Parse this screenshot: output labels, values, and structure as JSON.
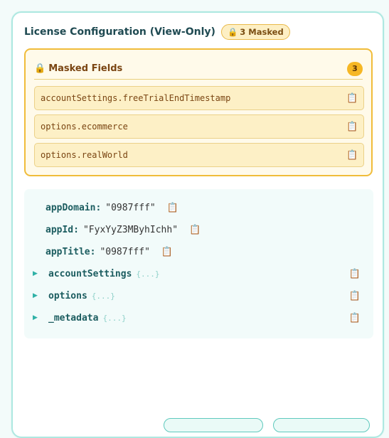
{
  "header": {
    "title": "License Configuration (View-Only)",
    "badge_icon": "lock-icon",
    "badge_label": "3 Masked"
  },
  "masked": {
    "title": "Masked Fields",
    "count": "3",
    "fields": [
      "accountSettings.freeTrialEndTimestamp",
      "options.ecommerce",
      "options.realWorld"
    ]
  },
  "tree": {
    "rows": [
      {
        "key": "appDomain:",
        "value": "\"0987fff\""
      },
      {
        "key": "appId:",
        "value": "\"FyxYyZ3MByhIchh\""
      },
      {
        "key": "appTitle:",
        "value": "\"0987fff\""
      }
    ],
    "groups": [
      {
        "key": "accountSettings",
        "brace": "{...}"
      },
      {
        "key": "options",
        "brace": "{...}"
      },
      {
        "key": "_metadata",
        "brace": "{...}"
      }
    ]
  },
  "colors": {
    "accent": "#2fb1a6",
    "warning": "#f0bc3a",
    "masked_bg": "#fffaea"
  },
  "icons": {
    "copy": "clipboard-icon",
    "lock": "lock-icon",
    "expand": "triangle-right-icon"
  }
}
